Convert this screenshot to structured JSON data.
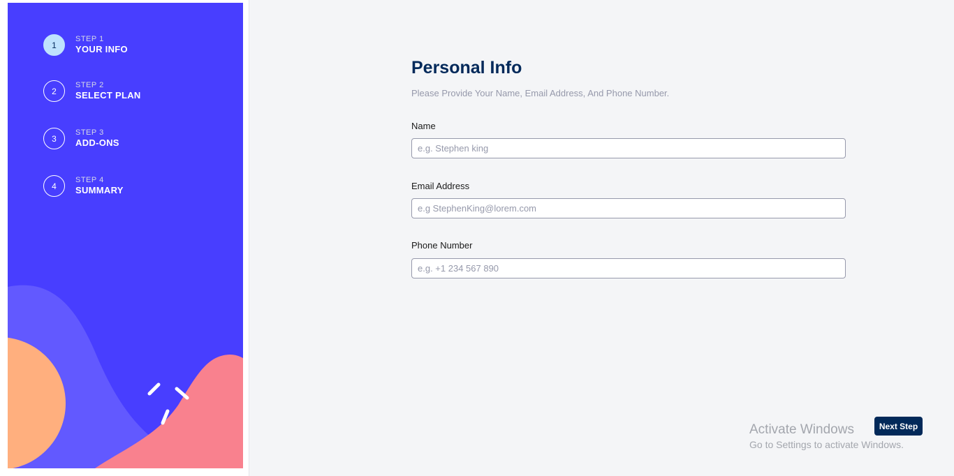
{
  "sidebar": {
    "steps": [
      {
        "number": "1",
        "label": "STEP 1",
        "title": "YOUR INFO",
        "active": true
      },
      {
        "number": "2",
        "label": "STEP 2",
        "title": "SELECT PLAN",
        "active": false
      },
      {
        "number": "3",
        "label": "STEP 3",
        "title": "ADD-ONS",
        "active": false
      },
      {
        "number": "4",
        "label": "STEP 4",
        "title": "SUMMARY",
        "active": false
      }
    ]
  },
  "main": {
    "title": "Personal Info",
    "subtitle": "Please Provide Your Name, Email Address, And Phone Number.",
    "fields": [
      {
        "label": "Name",
        "placeholder": "e.g. Stephen king",
        "value": ""
      },
      {
        "label": "Email Address",
        "placeholder": "e.g StephenKing@lorem.com",
        "value": ""
      },
      {
        "label": "Phone Number",
        "placeholder": "e.g. +1 234 567 890",
        "value": ""
      }
    ],
    "next_button": "Next Step"
  },
  "watermark": {
    "title": "Activate Windows",
    "subtitle": "Go to Settings to activate Windows."
  },
  "colors": {
    "sidebar_bg": "#483eff",
    "active_step": "#bfe2fd",
    "title": "#02295a",
    "button": "#022959",
    "blob_purple": "#6259ff",
    "blob_orange": "#ffaf7e",
    "blob_pink": "#f9818e"
  }
}
